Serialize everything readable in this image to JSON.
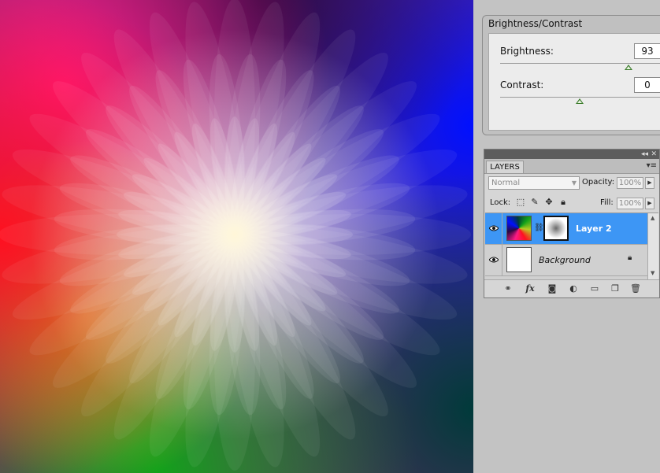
{
  "brightness_contrast": {
    "title": "Brightness/Contrast",
    "brightness_label": "Brightness:",
    "brightness_value": "93",
    "contrast_label": "Contrast:",
    "contrast_value": "0"
  },
  "layers_panel": {
    "tab_label": "LAYERS",
    "blend_mode": "Normal",
    "opacity_label": "Opacity:",
    "opacity_value": "100%",
    "lock_label": "Lock:",
    "fill_label": "Fill:",
    "fill_value": "100%",
    "layers": [
      {
        "name": "Layer 2",
        "selected": true
      },
      {
        "name": "Background",
        "selected": false
      }
    ],
    "bottom_icons": [
      "link-layers-icon",
      "fx-icon",
      "add-mask-icon",
      "adjustment-layer-icon",
      "new-group-icon",
      "new-layer-icon",
      "delete-layer-icon"
    ]
  },
  "colors": {
    "selection_blue": "#3d96f5",
    "panel_gray": "#d6d6d6",
    "workspace_gray": "#c3c3c3"
  }
}
